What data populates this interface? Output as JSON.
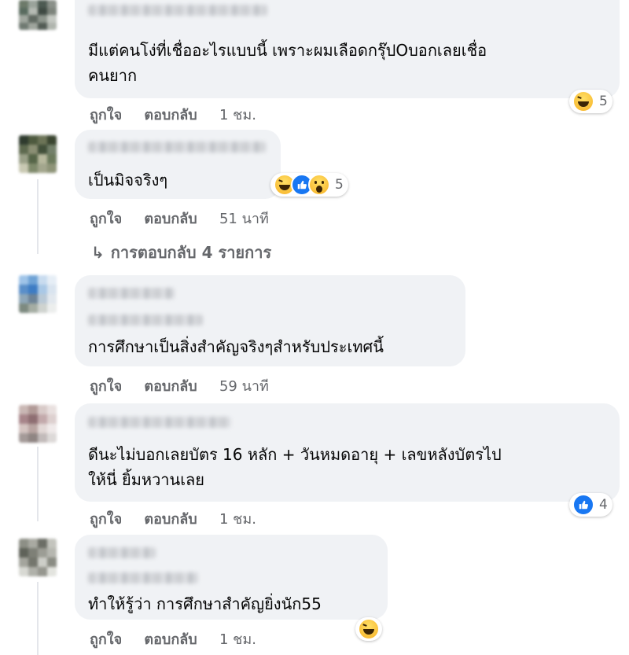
{
  "comments": [
    {
      "text": "มีแต่คนโง่ที่เชื่ออะไรแบบนี้ เพราะผมเลือดกรุ๊ปOบอกเลยเชื่อคนยาก",
      "line1": "มีแต่คนโง่ที่เชื่ออะไรแบบนี้ เพราะผมเลือดกรุ๊ปOบอกเลยเชื่อ",
      "line2": "คนยาก",
      "like": "ถูกใจ",
      "reply": "ตอบกลับ",
      "time": "1 ชม.",
      "reaction_icons": [
        "haha-icon"
      ],
      "reaction_count": "5"
    },
    {
      "text": "เป็นมิจจริงๆ",
      "like": "ถูกใจ",
      "reply": "ตอบกลับ",
      "time": "51 นาที",
      "reaction_icons": [
        "haha-icon",
        "like-icon",
        "wow-icon"
      ],
      "reaction_count": "5",
      "replies_arrow": "↳",
      "replies_label": "การตอบกลับ 4 รายการ"
    },
    {
      "text": "การศึกษาเป็นสิ่งสำคัญจริงๆสำหรับประเทศนี้",
      "like": "ถูกใจ",
      "reply": "ตอบกลับ",
      "time": "59 นาที"
    },
    {
      "text": "ดีนะไม่บอกเลยบัตร 16 หลัก + วันหมดอายุ + เลขหลังบัตรไปให้นี่ ยิ้มหวานเลย",
      "line1": "ดีนะไม่บอกเลยบัตร 16 หลัก + วันหมดอายุ + เลขหลังบัตรไป",
      "line2": "ให้นี่ ยิ้มหวานเลย",
      "like": "ถูกใจ",
      "reply": "ตอบกลับ",
      "time": "1 ชม.",
      "reaction_icons": [
        "like-icon"
      ],
      "reaction_count": "4"
    },
    {
      "text": "ทำให้รู้ว่า การศึกษาสำคัญยิ่งนัก55",
      "like": "ถูกใจ",
      "reply": "ตอบกลับ",
      "time": "1 ชม.",
      "reaction_icons": [
        "haha-icon"
      ]
    }
  ],
  "colors": {
    "bubble": "#f0f2f5",
    "action_text": "#65676b",
    "like_blue": "#1877f2",
    "haha_yellow": "#f7b125"
  }
}
